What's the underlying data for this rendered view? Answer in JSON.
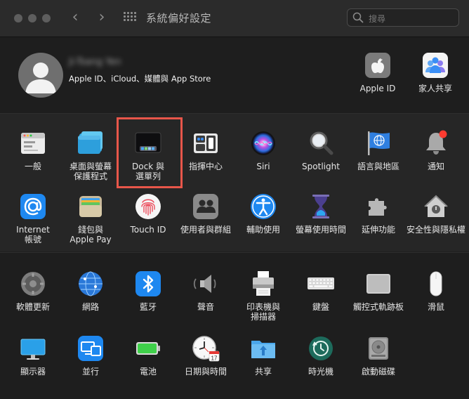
{
  "window": {
    "title": "系統偏好設定",
    "search_placeholder": "搜尋"
  },
  "account": {
    "name": "Ji-Tsang Yen",
    "subtitle": "Apple ID、iCloud、媒體與 App Store",
    "apple_id_label": "Apple ID",
    "family_label": "家人共享"
  },
  "row1": [
    {
      "label": "一般",
      "icon": "general-icon"
    },
    {
      "label": "桌面與螢幕\n保護程式",
      "icon": "desktop-screensaver-icon"
    },
    {
      "label": "Dock 與\n選單列",
      "icon": "dock-icon"
    },
    {
      "label": "指揮中心",
      "icon": "control-center-icon"
    },
    {
      "label": "Siri",
      "icon": "siri-icon"
    },
    {
      "label": "Spotlight",
      "icon": "spotlight-icon"
    },
    {
      "label": "語言與地區",
      "icon": "language-region-icon"
    },
    {
      "label": "通知",
      "icon": "notifications-icon"
    }
  ],
  "row2": [
    {
      "label": "Internet\n帳號",
      "icon": "internet-accounts-icon"
    },
    {
      "label": "錢包與\nApple Pay",
      "icon": "wallet-icon"
    },
    {
      "label": "Touch ID",
      "icon": "touch-id-icon"
    },
    {
      "label": "使用者與群組",
      "icon": "users-groups-icon"
    },
    {
      "label": "輔助使用",
      "icon": "accessibility-icon"
    },
    {
      "label": "螢幕使用時間",
      "icon": "screen-time-icon"
    },
    {
      "label": "延伸功能",
      "icon": "extensions-icon"
    },
    {
      "label": "安全性與隱私權",
      "icon": "security-privacy-icon"
    }
  ],
  "row3": [
    {
      "label": "軟體更新",
      "icon": "software-update-icon"
    },
    {
      "label": "網路",
      "icon": "network-icon"
    },
    {
      "label": "藍牙",
      "icon": "bluetooth-icon"
    },
    {
      "label": "聲音",
      "icon": "sound-icon"
    },
    {
      "label": "印表機與\n掃描器",
      "icon": "printer-icon"
    },
    {
      "label": "鍵盤",
      "icon": "keyboard-icon"
    },
    {
      "label": "觸控式軌跡板",
      "icon": "trackpad-icon"
    },
    {
      "label": "滑鼠",
      "icon": "mouse-icon"
    }
  ],
  "row4": [
    {
      "label": "顯示器",
      "icon": "display-icon"
    },
    {
      "label": "並行",
      "icon": "sidecar-icon"
    },
    {
      "label": "電池",
      "icon": "battery-icon"
    },
    {
      "label": "日期與時間",
      "icon": "date-time-icon"
    },
    {
      "label": "共享",
      "icon": "sharing-icon"
    },
    {
      "label": "時光機",
      "icon": "time-machine-icon"
    },
    {
      "label": "啟動磁碟",
      "icon": "startup-disk-icon"
    }
  ],
  "date_icon_day": "17",
  "colors": {
    "highlight": "#e8564a",
    "accent_blue": "#1e88f0"
  }
}
